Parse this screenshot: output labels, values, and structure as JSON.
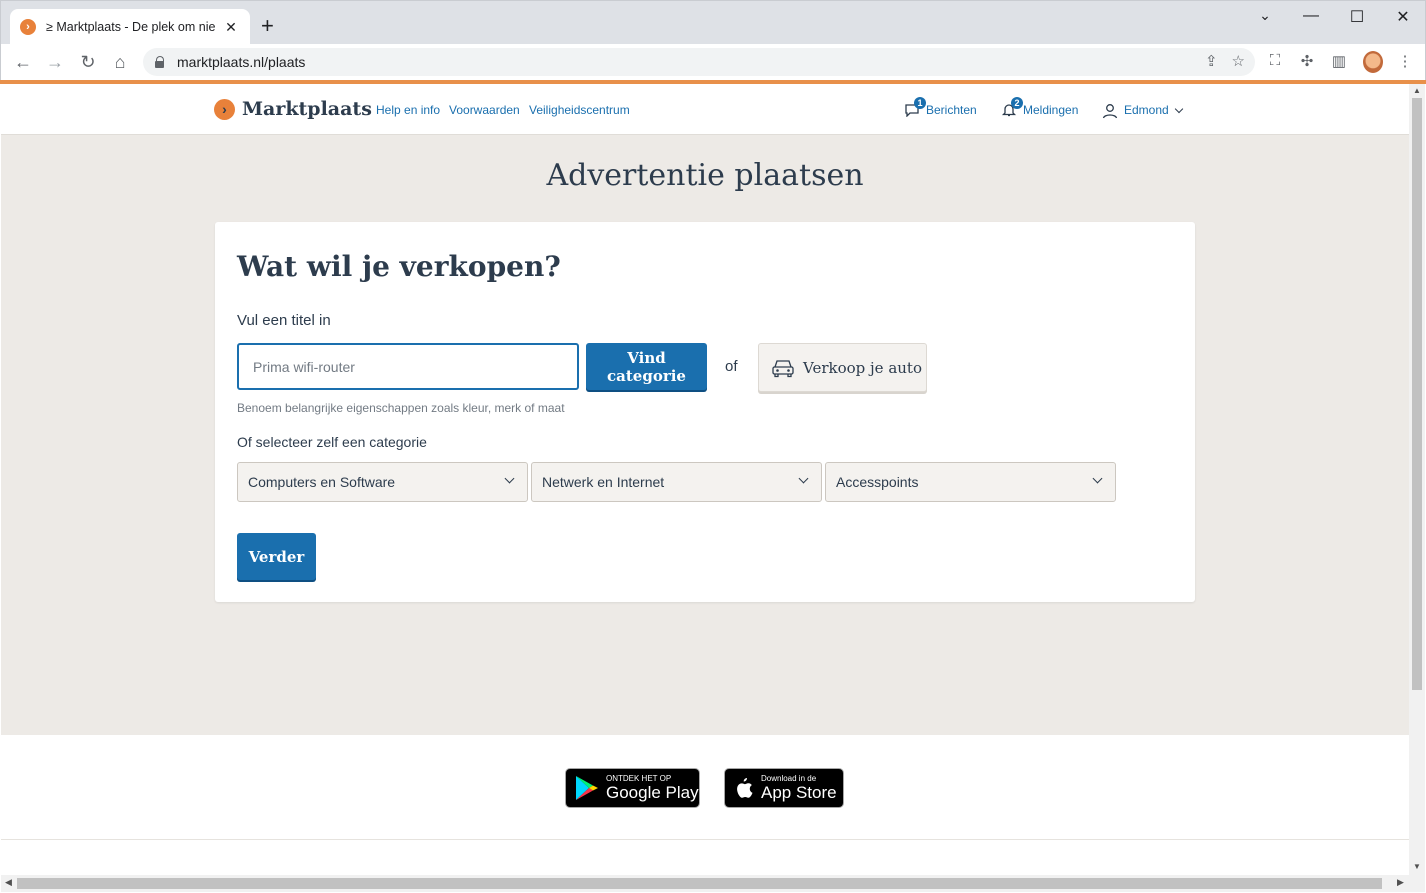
{
  "browser": {
    "tab_title": "≥ Marktplaats - De plek om nieuwe",
    "tab_favicon": "›",
    "url": "marktplaats.nl/plaats",
    "new_tab": "+"
  },
  "site": {
    "logo_text": "Marktplaats",
    "logo_mark": "›",
    "nav_links": [
      "Help en info",
      "Voorwaarden",
      "Veiligheidscentrum"
    ],
    "messages_label": "Berichten",
    "messages_count": "1",
    "notifications_label": "Meldingen",
    "notifications_count": "2",
    "user_name": "Edmond"
  },
  "page": {
    "title": "Advertentie plaatsen",
    "heading": "Wat wil je verkopen?",
    "title_label": "Vul een titel in",
    "title_value": "Prima wifi-router",
    "find_category_button": "Vind categorie",
    "or_text": "of",
    "sell_car_button": "Verkoop je auto",
    "helper_text": "Benoem belangrijke eigenschappen zoals kleur, merk of maat",
    "category_label": "Of selecteer zelf een categorie",
    "category_selects": [
      "Computers en Software",
      "Netwerk en Internet",
      "Accesspoints"
    ],
    "next_button": "Verder"
  },
  "footer": {
    "google_play_small": "ONTDEK HET OP",
    "google_play_big": "Google Play",
    "app_store_small": "Download in de",
    "app_store_big": "App Store"
  },
  "colors": {
    "brand_blue": "#1a6fae",
    "brand_orange": "#e8813a",
    "page_bg": "#edeae6"
  }
}
